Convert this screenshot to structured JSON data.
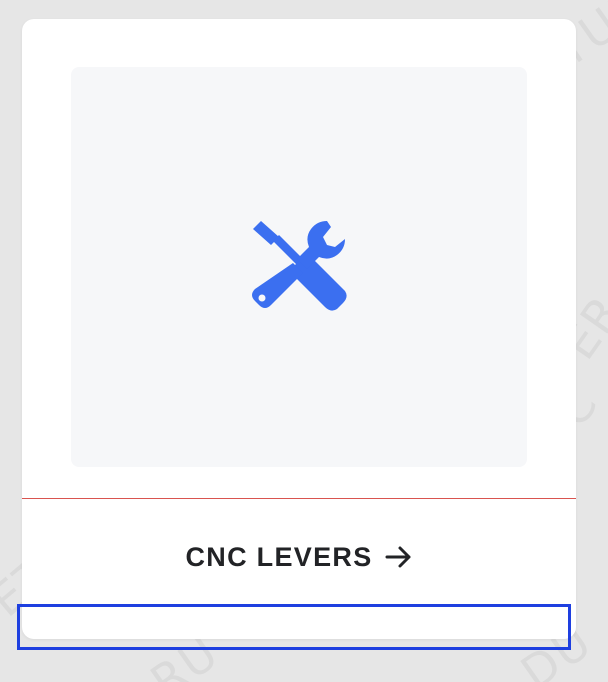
{
  "card": {
    "cta_label": "CNC LEVERS",
    "icon": "tools-icon",
    "arrow_icon": "arrow-right-icon"
  },
  "colors": {
    "icon_blue": "#3b6ff0",
    "divider_red": "#d9534f",
    "focus_outline": "#1e3fe0",
    "text_dark": "#222326"
  }
}
